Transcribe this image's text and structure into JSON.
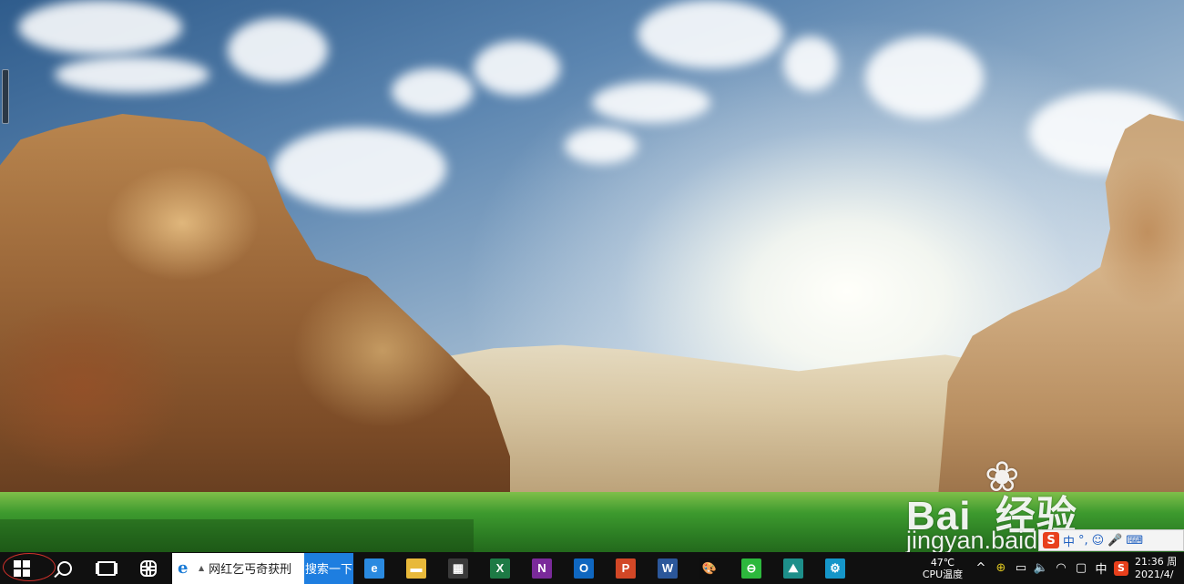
{
  "desktop": {
    "watermark": {
      "logo": "Bai  经验",
      "url_text": "jingyan.baidu.com"
    }
  },
  "ime_toolbar": {
    "logo": "S",
    "items": [
      "中",
      "°,",
      "☺",
      "🎤",
      "⌨"
    ]
  },
  "taskbar": {
    "search_box": {
      "value": "网红乞丐奇获刑",
      "button_label": "搜索一下",
      "browser_icon": "e"
    },
    "apps": [
      {
        "name": "edge-browser",
        "icon": "e",
        "color": "#2a8ae0"
      },
      {
        "name": "file-explorer",
        "icon": "▬",
        "color": "#e8b93a"
      },
      {
        "name": "microsoft-store",
        "icon": "▦",
        "color": "#3a3a3a"
      },
      {
        "name": "excel",
        "icon": "X",
        "color": "#1d7a45"
      },
      {
        "name": "onenote",
        "icon": "N",
        "color": "#7a2a9a"
      },
      {
        "name": "outlook",
        "icon": "O",
        "color": "#0f67c0"
      },
      {
        "name": "powerpoint",
        "icon": "P",
        "color": "#d24726"
      },
      {
        "name": "word",
        "icon": "W",
        "color": "#2b579a"
      },
      {
        "name": "paint",
        "icon": "🎨",
        "color": "#0f0f0f"
      },
      {
        "name": "360-browser",
        "icon": "⊖",
        "color": "#2db83d"
      },
      {
        "name": "image-viewer",
        "icon": "⛰",
        "color": "#1d8f8a"
      },
      {
        "name": "settings",
        "icon": "⚙",
        "color": "#1596c9"
      }
    ],
    "tray": {
      "cpu_temp": "47℃",
      "cpu_label": "CPU温度",
      "chevron": "^",
      "ime_indicator": "中",
      "sogou_icon": "S",
      "clock_time": "21:36 周",
      "clock_date": "2021/4/"
    }
  }
}
